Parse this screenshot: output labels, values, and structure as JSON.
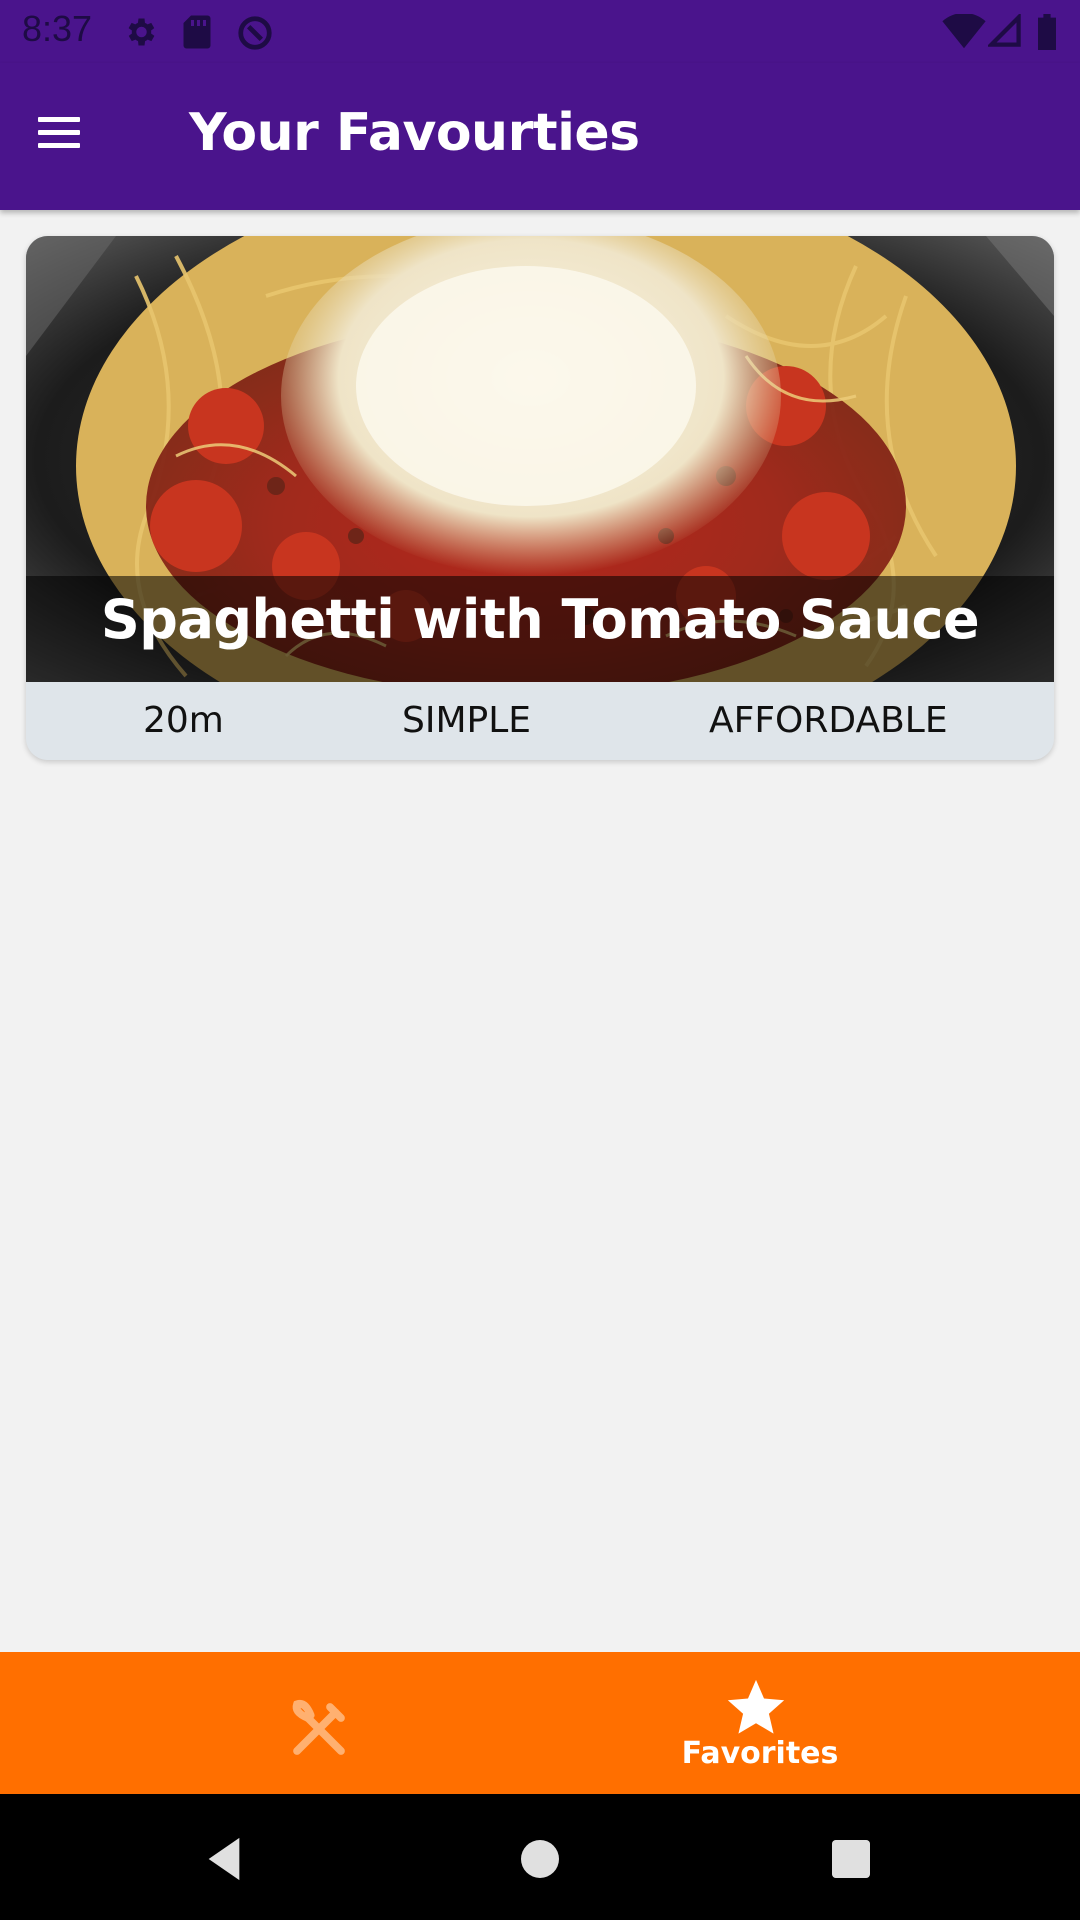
{
  "status_bar": {
    "time": "8:37"
  },
  "header": {
    "title": "Your Favourties"
  },
  "recipe": {
    "title": "Spaghetti with Tomato Sauce",
    "duration": "20m",
    "complexity": "SIMPLE",
    "affordability": "AFFORDABLE"
  },
  "tabs": [
    {
      "icon": "fork-knife-icon",
      "label": ""
    },
    {
      "icon": "star-icon",
      "label": "Favorites"
    }
  ],
  "colors": {
    "primary": "#4a148c",
    "accent": "#ff6f00",
    "card_footer": "#dfe5ea"
  }
}
